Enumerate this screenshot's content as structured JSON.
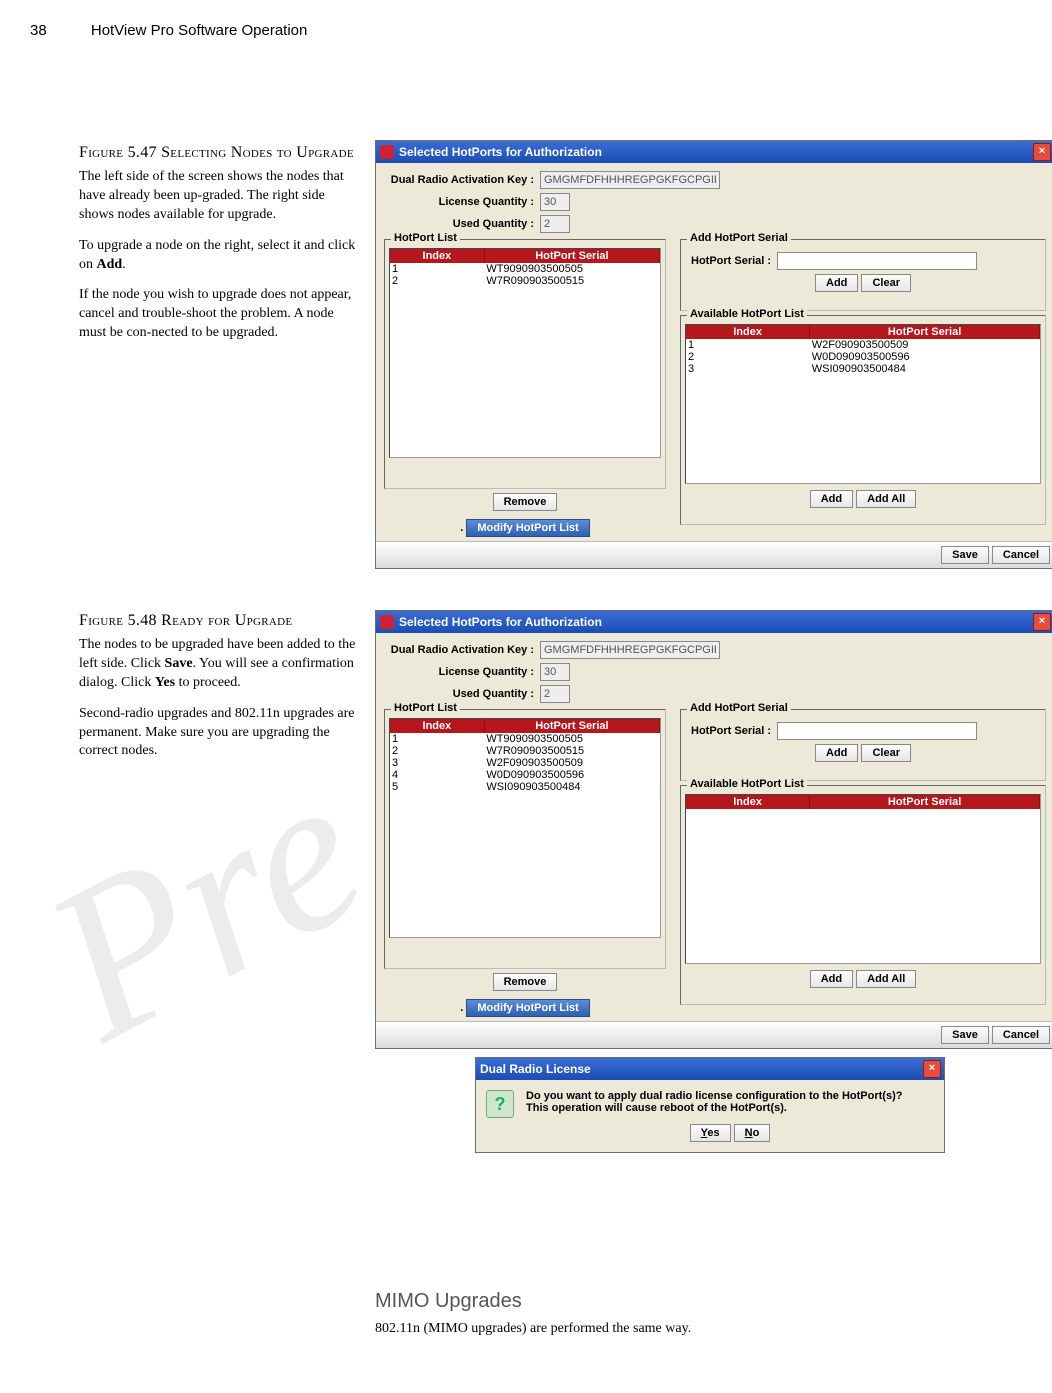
{
  "page": {
    "number": "38",
    "title": "HotView Pro Software Operation"
  },
  "fig547": {
    "title": "Figure 5.47 Selecting Nodes to Upgrade",
    "p1": "The left side of the screen shows the nodes that have already been up-graded. The right side shows nodes available for upgrade.",
    "p2_pre": "To upgrade a node on the right, select it and click on ",
    "p2_bold": "Add",
    "p2_post": ".",
    "p3": "If the node you wish to upgrade does not appear, cancel and trouble-shoot the problem. A node must be con-nected to be upgraded."
  },
  "fig548": {
    "title": "Figure 5.48 Ready for Upgrade",
    "p1_pre": "The nodes to be upgraded have been added to the left side. Click ",
    "p1_b1": "Save",
    "p1_mid": ". You will see a confirmation dialog. Click ",
    "p1_b2": "Yes",
    "p1_post": " to proceed.",
    "p2": "Second-radio upgrades and 802.11n upgrades are permanent. Make sure you are upgrading the correct nodes."
  },
  "dialog": {
    "title": "Selected HotPorts for Authorization",
    "key_label": "Dual Radio Activation Key :",
    "key_value": "GMGMFDFHHHREGPGKFGCPGIEF",
    "lic_label": "License Quantity :",
    "lic_value": "30",
    "used_label": "Used Quantity :",
    "used_value": "2",
    "hotport_list": "HotPort List",
    "add_serial": "Add HotPort Serial",
    "hotport_serial_label": "HotPort Serial :",
    "available": "Available HotPort List",
    "th_index": "Index",
    "th_serial": "HotPort Serial",
    "btn_add": "Add",
    "btn_clear": "Clear",
    "btn_add_all": "Add All",
    "btn_remove": "Remove",
    "btn_modify": "Modify HotPort List",
    "btn_save": "Save",
    "btn_cancel": "Cancel"
  },
  "list547_left": [
    {
      "i": "1",
      "s": "WT9090903500505"
    },
    {
      "i": "2",
      "s": "W7R090903500515"
    }
  ],
  "list547_right": [
    {
      "i": "1",
      "s": "W2F090903500509"
    },
    {
      "i": "2",
      "s": "W0D090903500596"
    },
    {
      "i": "3",
      "s": "WSI090903500484"
    }
  ],
  "list548_left": [
    {
      "i": "1",
      "s": "WT9090903500505"
    },
    {
      "i": "2",
      "s": "W7R090903500515"
    },
    {
      "i": "3",
      "s": "W2F090903500509"
    },
    {
      "i": "4",
      "s": "W0D090903500596"
    },
    {
      "i": "5",
      "s": "WSI090903500484"
    }
  ],
  "confirm": {
    "title": "Dual Radio License",
    "msg1": "Do you want to apply dual radio license configuration to the HotPort(s)?",
    "msg2": "This operation will cause reboot of the HotPort(s).",
    "yes": "Yes",
    "no": "No"
  },
  "mimo": {
    "heading": "MIMO Upgrades",
    "text": "802.11n (MIMO upgrades) are performed the same way."
  },
  "watermark": "Pre"
}
